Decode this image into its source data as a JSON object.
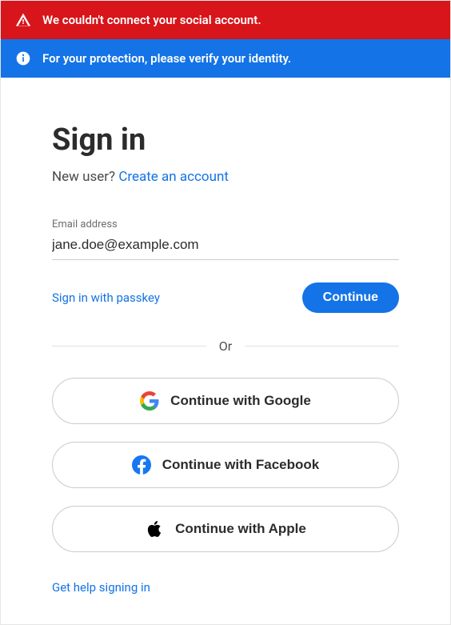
{
  "banners": {
    "error": "We couldn't connect your social account.",
    "info": "For your protection, please verify your identity."
  },
  "title": "Sign in",
  "new_user_prompt": "New user? ",
  "create_account_label": "Create an account",
  "email_field": {
    "label": "Email address",
    "value": "jane.doe@example.com"
  },
  "passkey_label": "Sign in with passkey",
  "continue_label": "Continue",
  "divider_label": "Or",
  "social": {
    "google": "Continue with Google",
    "facebook": "Continue with Facebook",
    "apple": "Continue with Apple"
  },
  "help_label": "Get help signing in"
}
